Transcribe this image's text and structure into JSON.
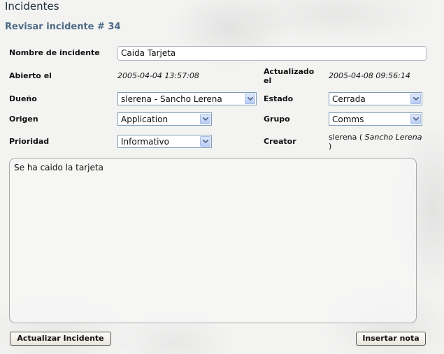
{
  "header": {
    "title": "Incidentes",
    "subtitle": "Revisar incidente # 34"
  },
  "form": {
    "name_label": "Nombre de incidente",
    "name_value": "Caida Tarjeta",
    "opened_label": "Abierto el",
    "opened_value": "2005-04-04 13:57:08",
    "updated_label_line1": "Actualizado",
    "updated_label_line2": "el",
    "updated_value": "2005-04-08 09:56:14",
    "owner_label": "Dueño",
    "owner_value": "slerena - Sancho Lerena",
    "status_label": "Estado",
    "status_value": "Cerrada",
    "origin_label": "Origen",
    "origin_value": "Application",
    "group_label": "Grupo",
    "group_value": "Comms",
    "priority_label": "Prioridad",
    "priority_value": "Informativo",
    "creator_label": "Creator",
    "creator_user": "slerena",
    "creator_open": "( ",
    "creator_fullname": "Sancho Lerena",
    "creator_close": ")",
    "description": "Se ha caido la tarjeta"
  },
  "actions": {
    "update_label": "Actualizar Incidente",
    "note_label": "Insertar nota"
  },
  "colors": {
    "title": "#1f2f3f",
    "subtitle": "#4d6a84",
    "select_border": "#7f9db9"
  },
  "icons": {
    "dropdown": "chevron-down-icon"
  }
}
